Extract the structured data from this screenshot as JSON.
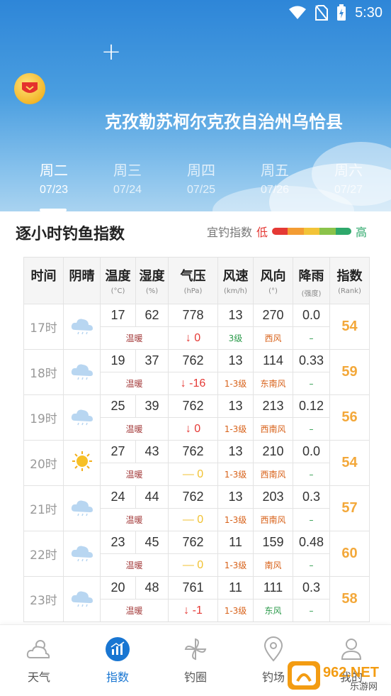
{
  "status": {
    "time": "5:30"
  },
  "header": {
    "location": "克孜勒苏柯尔克孜自治州乌恰县",
    "days": [
      {
        "name": "周二",
        "date": "07/23"
      },
      {
        "name": "周三",
        "date": "07/24"
      },
      {
        "name": "周四",
        "date": "07/25"
      },
      {
        "name": "周五",
        "date": "07/26"
      },
      {
        "name": "周六",
        "date": "07/27"
      }
    ]
  },
  "index": {
    "title": "逐小时钓鱼指数",
    "legend_label": "宜钓指数",
    "legend_low": "低",
    "legend_high": "高",
    "legend_colors": [
      "#e53935",
      "#f39c33",
      "#f2c338",
      "#8bc34a",
      "#2ea86b"
    ]
  },
  "table": {
    "headers": [
      {
        "main": "时间",
        "sub": ""
      },
      {
        "main": "阴晴",
        "sub": ""
      },
      {
        "main": "温度",
        "sub": "(°C)"
      },
      {
        "main": "湿度",
        "sub": "(%)"
      },
      {
        "main": "气压",
        "sub": "(hPa)"
      },
      {
        "main": "风速",
        "sub": "(km/h)"
      },
      {
        "main": "风向",
        "sub": "(°)"
      },
      {
        "main": "降雨",
        "sub": "(强度)"
      },
      {
        "main": "指数",
        "sub": "(Rank)"
      }
    ],
    "rows": [
      {
        "time": "17时",
        "icon": "cloudy",
        "temp": "17",
        "humidity": "62",
        "pressure": "778",
        "wind_speed": "13",
        "wind_dir": "270",
        "rain": "0.0",
        "rank": "54",
        "temp_desc": "温暖",
        "pressure_change": "0",
        "pressure_trend": "down",
        "wind_level": "3级",
        "wind_dir_name": "西风",
        "rain_desc": "–"
      },
      {
        "time": "18时",
        "icon": "cloudy",
        "temp": "19",
        "humidity": "37",
        "pressure": "762",
        "wind_speed": "13",
        "wind_dir": "114",
        "rain": "0.33",
        "rank": "59",
        "temp_desc": "温暖",
        "pressure_change": "-16",
        "pressure_trend": "down",
        "wind_level": "1-3级",
        "wind_dir_name": "东南风",
        "rain_desc": "–"
      },
      {
        "time": "19时",
        "icon": "cloudy",
        "temp": "25",
        "humidity": "39",
        "pressure": "762",
        "wind_speed": "13",
        "wind_dir": "213",
        "rain": "0.12",
        "rank": "56",
        "temp_desc": "温暖",
        "pressure_change": "0",
        "pressure_trend": "down",
        "wind_level": "1-3级",
        "wind_dir_name": "西南风",
        "rain_desc": "–"
      },
      {
        "time": "20时",
        "icon": "sunny",
        "temp": "27",
        "humidity": "43",
        "pressure": "762",
        "wind_speed": "13",
        "wind_dir": "210",
        "rain": "0.0",
        "rank": "54",
        "temp_desc": "温暖",
        "pressure_change": "0",
        "pressure_trend": "flat",
        "wind_level": "1-3级",
        "wind_dir_name": "西南风",
        "rain_desc": "–"
      },
      {
        "time": "21时",
        "icon": "cloudy",
        "temp": "24",
        "humidity": "44",
        "pressure": "762",
        "wind_speed": "13",
        "wind_dir": "203",
        "rain": "0.3",
        "rank": "57",
        "temp_desc": "温暖",
        "pressure_change": "0",
        "pressure_trend": "flat",
        "wind_level": "1-3级",
        "wind_dir_name": "西南风",
        "rain_desc": "–"
      },
      {
        "time": "22时",
        "icon": "cloudy",
        "temp": "23",
        "humidity": "45",
        "pressure": "762",
        "wind_speed": "11",
        "wind_dir": "159",
        "rain": "0.48",
        "rank": "60",
        "temp_desc": "温暖",
        "pressure_change": "0",
        "pressure_trend": "flat",
        "wind_level": "1-3级",
        "wind_dir_name": "南风",
        "rain_desc": "–"
      },
      {
        "time": "23时",
        "icon": "cloudy",
        "temp": "20",
        "humidity": "48",
        "pressure": "761",
        "wind_speed": "11",
        "wind_dir": "111",
        "rain": "0.3",
        "rank": "58",
        "temp_desc": "温暖",
        "pressure_change": "-1",
        "pressure_trend": "down",
        "wind_level": "1-3级",
        "wind_dir_name": "东风",
        "rain_desc": "–"
      }
    ]
  },
  "nav": [
    {
      "label": "天气",
      "icon": "weather-icon"
    },
    {
      "label": "指数",
      "icon": "index-icon"
    },
    {
      "label": "钓圈",
      "icon": "pinwheel-icon"
    },
    {
      "label": "钓场",
      "icon": "location-pin-icon"
    },
    {
      "label": "我的",
      "icon": "user-icon"
    }
  ],
  "watermark": {
    "text": "962.NET",
    "sub": "乐游网"
  }
}
